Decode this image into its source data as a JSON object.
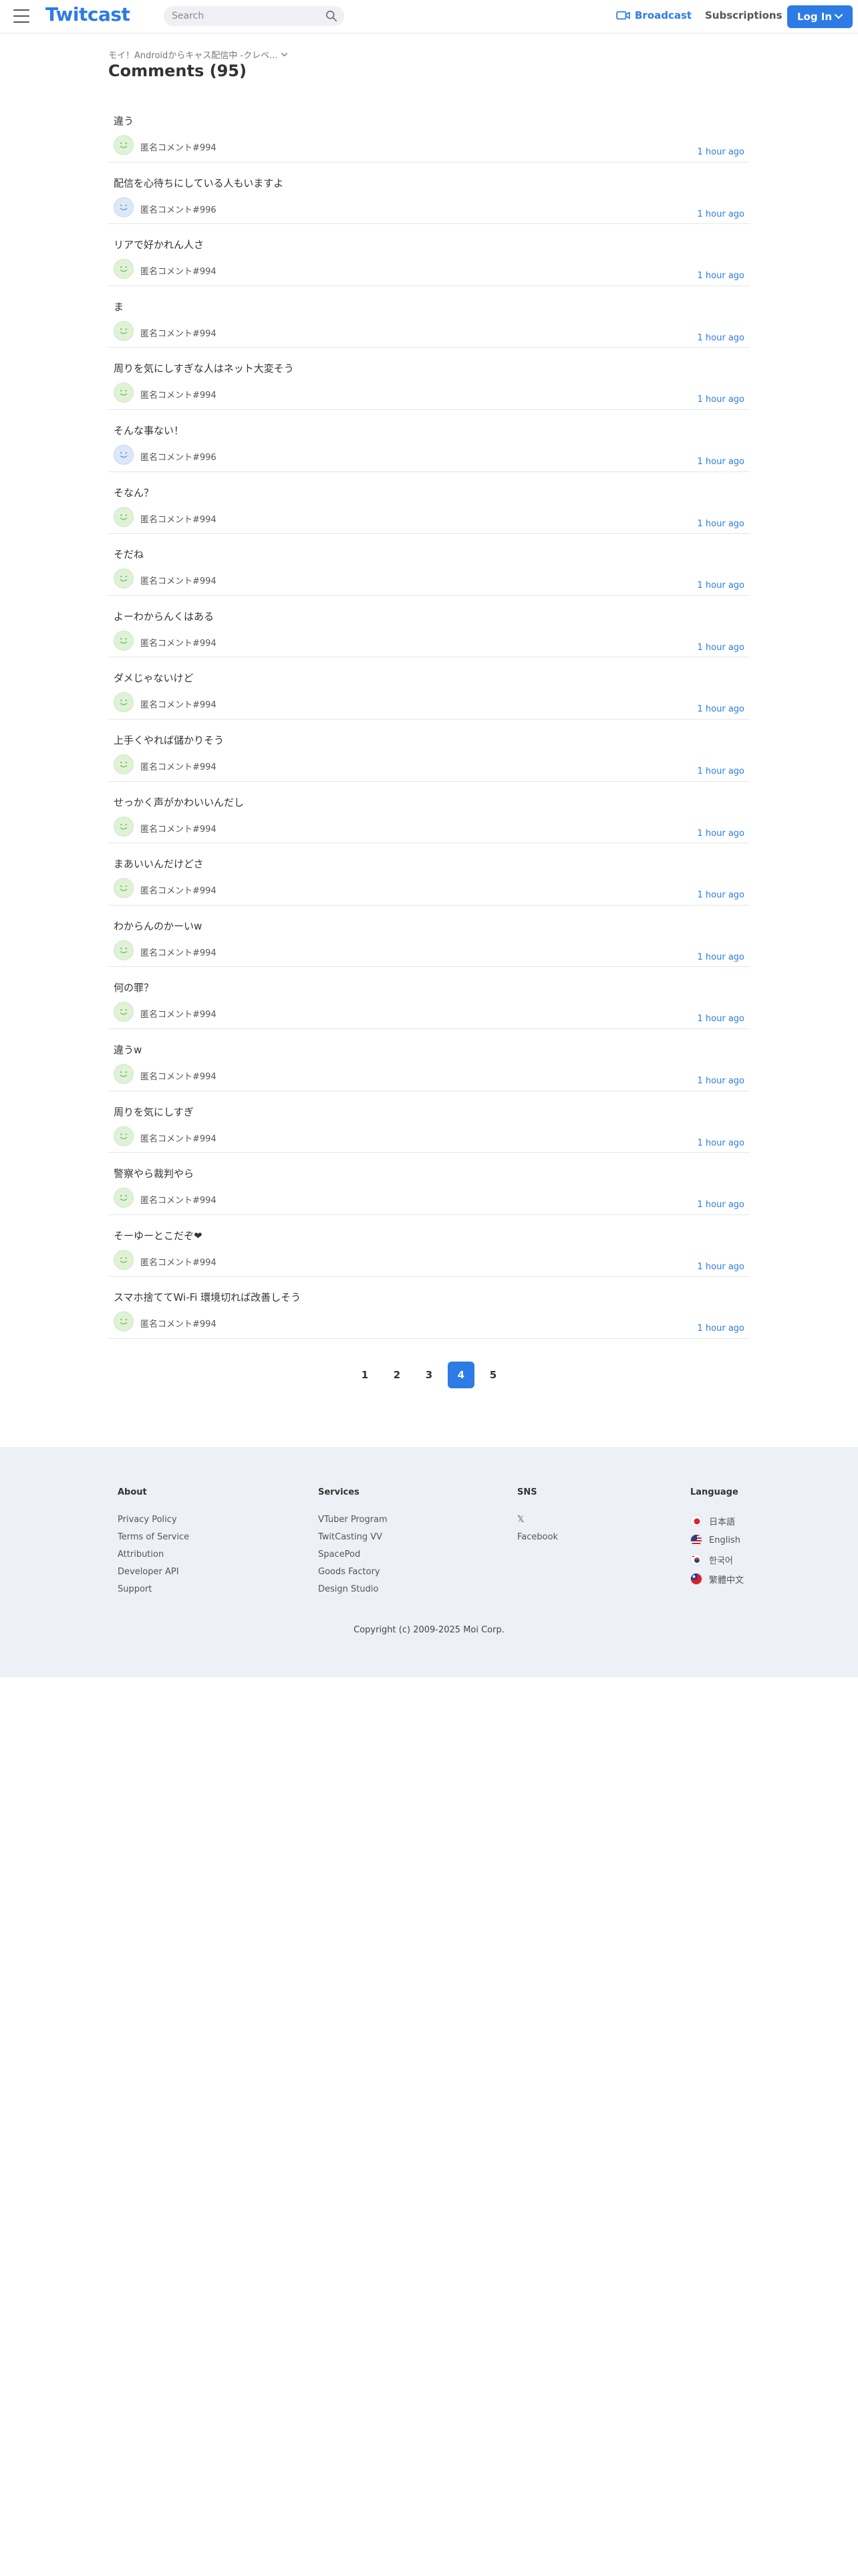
{
  "header": {
    "logo": "Twitcast",
    "search_placeholder": "Search",
    "broadcast_label": "Broadcast",
    "subscriptions_label": "Subscriptions",
    "login_label": "Log In"
  },
  "breadcrumb": "モイ！Androidからキャス配信中 -クレベ...",
  "page_title": "Comments (95)",
  "comments": [
    {
      "text": "違う",
      "author": "匿名コメント#994",
      "time": "1 hour ago",
      "avatar": "green"
    },
    {
      "text": "配信を心待ちにしている人もいますよ",
      "author": "匿名コメント#996",
      "time": "1 hour ago",
      "avatar": "blue"
    },
    {
      "text": "リアで好かれん人さ",
      "author": "匿名コメント#994",
      "time": "1 hour ago",
      "avatar": "green"
    },
    {
      "text": "ま",
      "author": "匿名コメント#994",
      "time": "1 hour ago",
      "avatar": "green"
    },
    {
      "text": "周りを気にしすぎな人はネット大変そう",
      "author": "匿名コメント#994",
      "time": "1 hour ago",
      "avatar": "green"
    },
    {
      "text": "そんな事ない！",
      "author": "匿名コメント#996",
      "time": "1 hour ago",
      "avatar": "blue"
    },
    {
      "text": "そなん？",
      "author": "匿名コメント#994",
      "time": "1 hour ago",
      "avatar": "green"
    },
    {
      "text": "そだね",
      "author": "匿名コメント#994",
      "time": "1 hour ago",
      "avatar": "green"
    },
    {
      "text": "よーわからんくはある",
      "author": "匿名コメント#994",
      "time": "1 hour ago",
      "avatar": "green"
    },
    {
      "text": "ダメじゃないけど",
      "author": "匿名コメント#994",
      "time": "1 hour ago",
      "avatar": "green"
    },
    {
      "text": "上手くやれば儲かりそう",
      "author": "匿名コメント#994",
      "time": "1 hour ago",
      "avatar": "green"
    },
    {
      "text": "せっかく声がかわいいんだし",
      "author": "匿名コメント#994",
      "time": "1 hour ago",
      "avatar": "green"
    },
    {
      "text": "まあいいんだけどさ",
      "author": "匿名コメント#994",
      "time": "1 hour ago",
      "avatar": "green"
    },
    {
      "text": "わからんのかーいw",
      "author": "匿名コメント#994",
      "time": "1 hour ago",
      "avatar": "green"
    },
    {
      "text": "何の罪？",
      "author": "匿名コメント#994",
      "time": "1 hour ago",
      "avatar": "green"
    },
    {
      "text": "違うw",
      "author": "匿名コメント#994",
      "time": "1 hour ago",
      "avatar": "green"
    },
    {
      "text": "周りを気にしすぎ",
      "author": "匿名コメント#994",
      "time": "1 hour ago",
      "avatar": "green"
    },
    {
      "text": "警察やら裁判やら",
      "author": "匿名コメント#994",
      "time": "1 hour ago",
      "avatar": "green"
    },
    {
      "text": "そーゆーとこだぞ❤",
      "author": "匿名コメント#994",
      "time": "1 hour ago",
      "avatar": "green"
    },
    {
      "text": "スマホ捨ててWi-Fi 環境切れば改善しそう",
      "author": "匿名コメント#994",
      "time": "1 hour ago",
      "avatar": "green"
    }
  ],
  "pagination": {
    "pages": [
      "1",
      "2",
      "3",
      "4",
      "5"
    ],
    "current": "4"
  },
  "footer": {
    "about": {
      "heading": "About",
      "links": [
        "Privacy Policy",
        "Terms of Service",
        "Attribution",
        "Developer API",
        "Support"
      ]
    },
    "services": {
      "heading": "Services",
      "links": [
        "VTuber Program",
        "TwitCasting VV",
        "SpacePod",
        "Goods Factory",
        "Design Studio"
      ]
    },
    "sns": {
      "heading": "SNS",
      "links": [
        "𝕏",
        "Facebook"
      ]
    },
    "language": {
      "heading": "Language",
      "items": [
        {
          "label": "日本語",
          "flag": "jp"
        },
        {
          "label": "English",
          "flag": "us"
        },
        {
          "label": "한국어",
          "flag": "kr"
        },
        {
          "label": "繁體中文",
          "flag": "tw"
        }
      ]
    },
    "copyright": "Copyright (c) 2009-2025 Moi Corp."
  },
  "colors": {
    "accent": "#2d7be5",
    "footer_bg": "#edf0f6",
    "divider": "#e3e6ea"
  }
}
